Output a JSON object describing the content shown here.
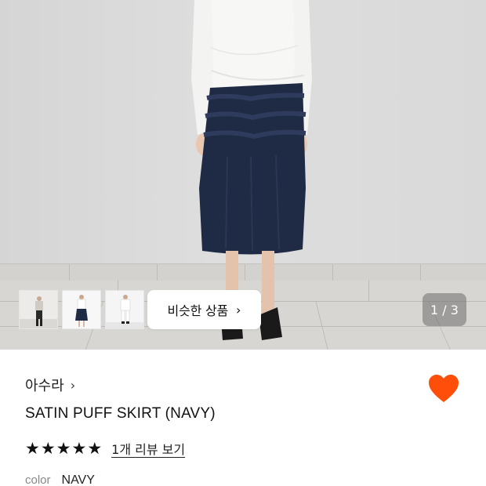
{
  "gallery": {
    "similar_button_label": "비슷한 상품",
    "chevron": "›",
    "counter": "1 / 3",
    "thumbnails": [
      {
        "label": "thumbnail-1"
      },
      {
        "label": "thumbnail-2"
      },
      {
        "label": "thumbnail-3"
      }
    ]
  },
  "product": {
    "brand": "아수라",
    "brand_chevron": "›",
    "title": "SATIN PUFF SKIRT (NAVY)",
    "rating_stars": 5,
    "review_link": "1개 리뷰 보기",
    "wishlist_icon": "heart-icon",
    "wishlist_color": "#ff4d0a",
    "option_key": "color",
    "option_value": "NAVY"
  }
}
